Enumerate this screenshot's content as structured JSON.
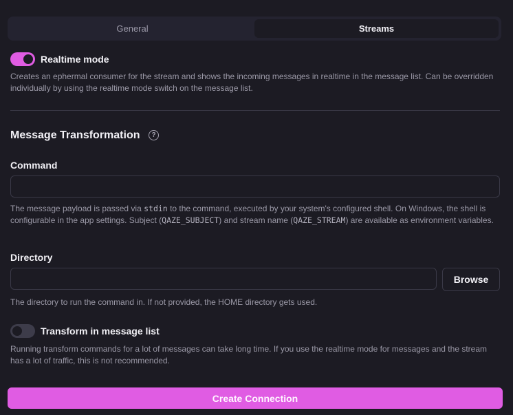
{
  "tabs": [
    {
      "label": "General",
      "active": false
    },
    {
      "label": "Streams",
      "active": true
    }
  ],
  "realtime": {
    "label": "Realtime mode",
    "enabled": true,
    "description": "Creates an ephermal consumer for the stream and shows the incoming messages in realtime in the message list. Can be overridden individually by using the realtime mode switch on the message list."
  },
  "transformation": {
    "title": "Message Transformation",
    "help_icon": "question-circle-icon",
    "command": {
      "label": "Command",
      "value": "",
      "placeholder": "",
      "description_parts": {
        "p1": "The message payload is passed via ",
        "code1": "stdin",
        "p2": " to the command, executed by your system's configured shell. On Windows, the shell is configurable in the app settings. Subject (",
        "code2": "QAZE_SUBJECT",
        "p3": ") and stream name (",
        "code3": "QAZE_STREAM",
        "p4": ") are available as environment variables."
      }
    },
    "directory": {
      "label": "Directory",
      "value": "",
      "placeholder": "",
      "browse_label": "Browse",
      "description": "The directory to run the command in. If not provided, the HOME directory gets used."
    },
    "transform_list": {
      "label": "Transform in message list",
      "enabled": false,
      "description": "Running transform commands for a lot of messages can take long time. If you use the realtime mode for messages and the stream has a lot of traffic, this is not recommended."
    }
  },
  "footer": {
    "create_label": "Create Connection"
  },
  "colors": {
    "accent": "#e05ce3",
    "background": "#1c1b23"
  }
}
